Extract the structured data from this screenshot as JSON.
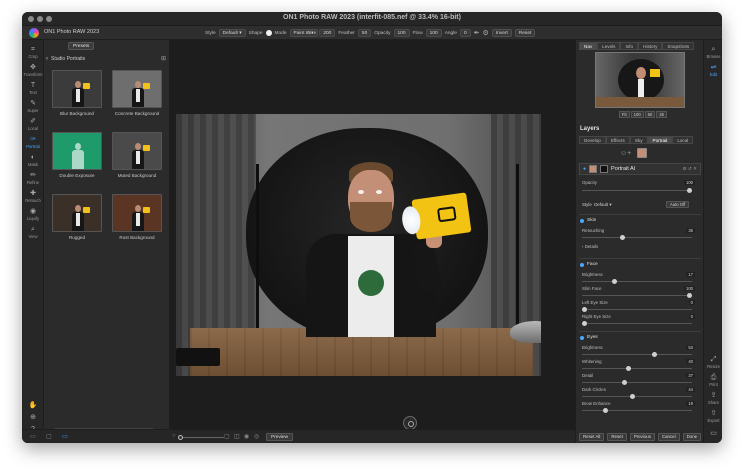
{
  "window": {
    "title": "ON1 Photo RAW 2023 (interfit-085.nef @ 33.4% 16-bit)"
  },
  "toolbar": {
    "app_name": "ON1 Photo RAW 2023",
    "style_label": "Style",
    "style_value": "Default",
    "shape_label": "Shape",
    "mode_label": "Mode",
    "mode_value": "Paint In",
    "size_label": "Size",
    "size_value": "200",
    "feather_label": "Feather",
    "feather_value": "50",
    "opacity_label": "Opacity",
    "opacity_value": "100",
    "flow_label": "Flow",
    "flow_value": "100",
    "angle_label": "Angle",
    "angle_value": "0",
    "invert_label": "Invert",
    "reset_label": "Reset"
  },
  "rail": [
    {
      "label": "Crop",
      "icon": "crop-icon",
      "glyph": "⌗"
    },
    {
      "label": "Transform",
      "icon": "transform-icon",
      "glyph": "✥"
    },
    {
      "label": "Text",
      "icon": "text-icon",
      "glyph": "T"
    },
    {
      "label": "Super",
      "icon": "super-brush-icon",
      "glyph": "✎"
    },
    {
      "label": "Local",
      "icon": "local-brush-icon",
      "glyph": "✐"
    },
    {
      "label": "Portrait",
      "icon": "portrait-icon",
      "glyph": "✑"
    },
    {
      "label": "Mask",
      "icon": "mask-icon",
      "glyph": "◐"
    },
    {
      "label": "Refine",
      "icon": "refine-icon",
      "glyph": "✏"
    },
    {
      "label": "Retouch",
      "icon": "retouch-icon",
      "glyph": "✚"
    },
    {
      "label": "Liquify",
      "icon": "liquify-icon",
      "glyph": "◉"
    },
    {
      "label": "View",
      "icon": "view-icon",
      "glyph": "⌕"
    }
  ],
  "browser": {
    "presets_tab": "Presets",
    "category": "Studio Portraits",
    "search_placeholder": "Search",
    "presets": [
      {
        "label": "Blur Background",
        "bg": "#3b3b3b"
      },
      {
        "label": "Concrete Background",
        "bg": "#6e6e6e"
      },
      {
        "label": "Double Exposure",
        "bg": "#1f9a6b"
      },
      {
        "label": "Muted Background",
        "bg": "#4a4a4a"
      },
      {
        "label": "Rugged",
        "bg": "#3a3028"
      },
      {
        "label": "Rust Background",
        "bg": "#5a3524"
      }
    ]
  },
  "statusbar": {
    "preview_label": "Preview"
  },
  "right_panel": {
    "nav_tabs": [
      "Nav",
      "Levels",
      "Info",
      "History",
      "Snapshots"
    ],
    "zoom_buttons": [
      "Fit",
      "100",
      "50",
      "25"
    ],
    "layers_title": "Layers",
    "module_tabs": [
      "Develop",
      "Effects",
      "Sky",
      "Portrait",
      "Local"
    ],
    "filter_name": "Portrait AI",
    "opacity_label": "Opacity",
    "opacity_value": "100",
    "style_label": "Style",
    "style_value": "Default",
    "auto_off_label": "Auto Off",
    "skin": {
      "title": "Skin",
      "retouching_label": "Retouching",
      "retouching_value": "35",
      "details_label": "Details"
    },
    "face": {
      "title": "Face",
      "rows": [
        {
          "label": "Brightness",
          "value": "17"
        },
        {
          "label": "Slim Face",
          "value": "100"
        },
        {
          "label": "Left Eye Size",
          "value": "0"
        },
        {
          "label": "Right Eye Size",
          "value": "0"
        }
      ]
    },
    "eyes": {
      "title": "Eyes",
      "rows": [
        {
          "label": "Brightness",
          "value": "53"
        },
        {
          "label": "Whitening",
          "value": "40"
        },
        {
          "label": "Detail",
          "value": "37"
        },
        {
          "label": "Dark Circles",
          "value": "44"
        },
        {
          "label": "Brow Enhance",
          "value": "19"
        }
      ]
    },
    "bottom_buttons": [
      "Reset All",
      "Reset",
      "Previous",
      "Cancel",
      "Done"
    ]
  },
  "modbar": [
    {
      "label": "Browse",
      "icon": "browse-icon",
      "glyph": "⌕"
    },
    {
      "label": "Edit",
      "icon": "edit-icon",
      "glyph": "⇌"
    },
    {
      "label": "Resize",
      "icon": "resize-icon",
      "glyph": "⤢"
    },
    {
      "label": "Print",
      "icon": "print-icon",
      "glyph": "⎙"
    },
    {
      "label": "Share",
      "icon": "share-icon",
      "glyph": "⇪"
    },
    {
      "label": "Export",
      "icon": "export-icon",
      "glyph": "⇧"
    }
  ]
}
